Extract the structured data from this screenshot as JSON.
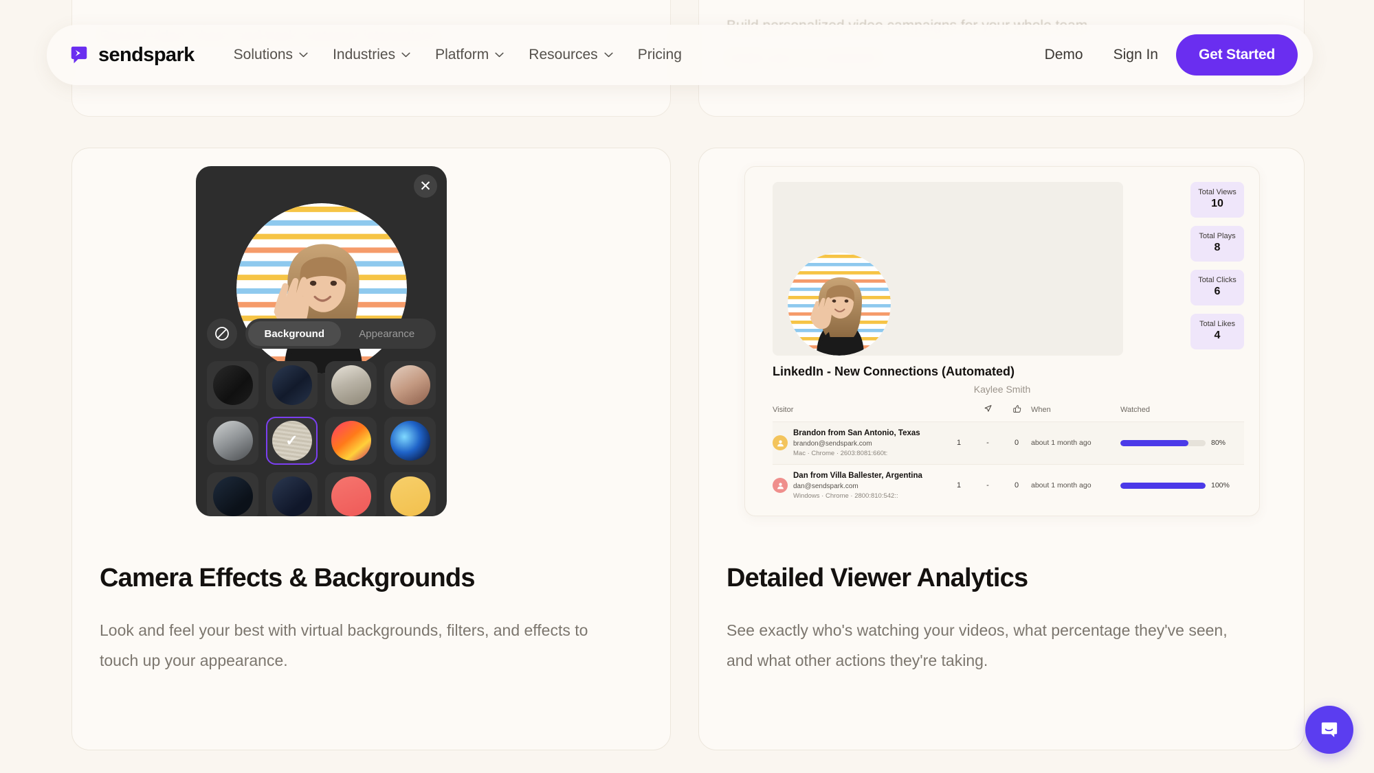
{
  "brand": {
    "name": "sendspark",
    "logo_icon": "sendspark-play-bubble-logo"
  },
  "nav": {
    "links": [
      {
        "label": "Solutions",
        "has_dropdown": true
      },
      {
        "label": "Industries",
        "has_dropdown": true
      },
      {
        "label": "Platform",
        "has_dropdown": true
      },
      {
        "label": "Resources",
        "has_dropdown": true
      },
      {
        "label": "Pricing",
        "has_dropdown": false
      }
    ],
    "demo_label": "Demo",
    "signin_label": "Sign In",
    "cta_label": "Get Started",
    "cta_color": "#6a2ef0"
  },
  "ghost_cards": {
    "left_line1": "Record video, share, and track customer interactions.",
    "right_line1": "Build personalized video campaigns for your whole team.",
    "right_line2": "Scale your 1:1 outreach."
  },
  "cards": [
    {
      "title": "Camera Effects & Backgrounds",
      "description": "Look and feel your best with virtual backgrounds, filters, and effects to touch up your appearance."
    },
    {
      "title": "Detailed Viewer Analytics",
      "description": "See exactly who's watching your videos, what percentage they've seen, and what other actions they're taking."
    }
  ],
  "camera_panel": {
    "close_icon": "close-x-icon",
    "no_background_icon": "no-background-prohibition-icon",
    "tabs": [
      {
        "label": "Background",
        "active": true
      },
      {
        "label": "Appearance",
        "active": false
      }
    ],
    "selected_index": 5,
    "selection_color": "#7b3ff2",
    "check_icon": "checkmark-icon",
    "backgrounds": [
      {
        "name": "black-texture",
        "swatch": "linear-gradient(135deg,#2a2a2a,#101010 60%,#1d1d1d)"
      },
      {
        "name": "navy-texture",
        "swatch": "linear-gradient(140deg,#2c3a52,#121a2b 55%,#26334a)"
      },
      {
        "name": "bright-living-room",
        "swatch": "linear-gradient(160deg,#e7e2d8,#b9b3a6 45%,#8e8777)"
      },
      {
        "name": "warm-brick-room",
        "swatch": "linear-gradient(150deg,#e4cfc0,#c49a82 50%,#8d5f4b)"
      },
      {
        "name": "industrial-office",
        "swatch": "linear-gradient(150deg,#cfd2d2,#8e9295 50%,#4a4d50)"
      },
      {
        "name": "beige-wave-pattern",
        "swatch": "repeating-linear-gradient(8deg,#d8d2c4 0 3px,#c9c2b2 3px 6px)"
      },
      {
        "name": "orange-red-waves",
        "swatch": "linear-gradient(140deg,#ff3b6b,#ff7a1a 45%,#ffd03a 70%,#c62368)"
      },
      {
        "name": "blue-galaxy",
        "swatch": "radial-gradient(circle at 35% 40%,#7fd9ff,#1f63c8 45%,#0a1d4a 85%)"
      },
      {
        "name": "dark-blue-texture",
        "swatch": "linear-gradient(140deg,#1e2b3c,#0b1119 70%)"
      },
      {
        "name": "navy-rock-texture",
        "swatch": "linear-gradient(140deg,#2b3850,#10172a 70%)"
      },
      {
        "name": "coral-solid",
        "swatch": "linear-gradient(160deg,#f5756e,#ef5a58)"
      },
      {
        "name": "yellow-solid",
        "swatch": "linear-gradient(160deg,#f7cf6a,#f2c04d)"
      }
    ]
  },
  "analytics_panel": {
    "video_title": "LinkedIn - New Connections (Automated)",
    "video_author": "Kaylee Smith",
    "stats": [
      {
        "label": "Total Views",
        "value": "10"
      },
      {
        "label": "Total Plays",
        "value": "8"
      },
      {
        "label": "Total Clicks",
        "value": "6"
      },
      {
        "label": "Total Likes",
        "value": "4"
      }
    ],
    "table": {
      "headers": {
        "visitor": "Visitor",
        "plays_icon": "play-icon",
        "clicks_icon": "cursor-click-icon",
        "likes_icon": "thumbs-up-icon",
        "when": "When",
        "watched": "Watched"
      },
      "rows": [
        {
          "name": "Brandon from San Antonio, Texas",
          "email": "brandon@sendspark.com",
          "meta": "Mac · Chrome · 2603:8081:660t:",
          "avatar_color": "#f3c45c",
          "plays": "1",
          "clicks": "-",
          "likes": "0",
          "when": "about 1 month ago",
          "watched_pct": 80,
          "watched_label": "80%"
        },
        {
          "name": "Dan from Villa Ballester, Argentina",
          "email": "dan@sendspark.com",
          "meta": "Windows · Chrome · 2800:810:542::",
          "avatar_color": "#ef8f8c",
          "plays": "1",
          "clicks": "-",
          "likes": "0",
          "when": "about 1 month ago",
          "watched_pct": 100,
          "watched_label": "100%"
        }
      ]
    },
    "progress_color": "#4b3ae8"
  },
  "chat_widget": {
    "icon": "chat-bubble-smile-icon",
    "color": "#5b3df0"
  }
}
